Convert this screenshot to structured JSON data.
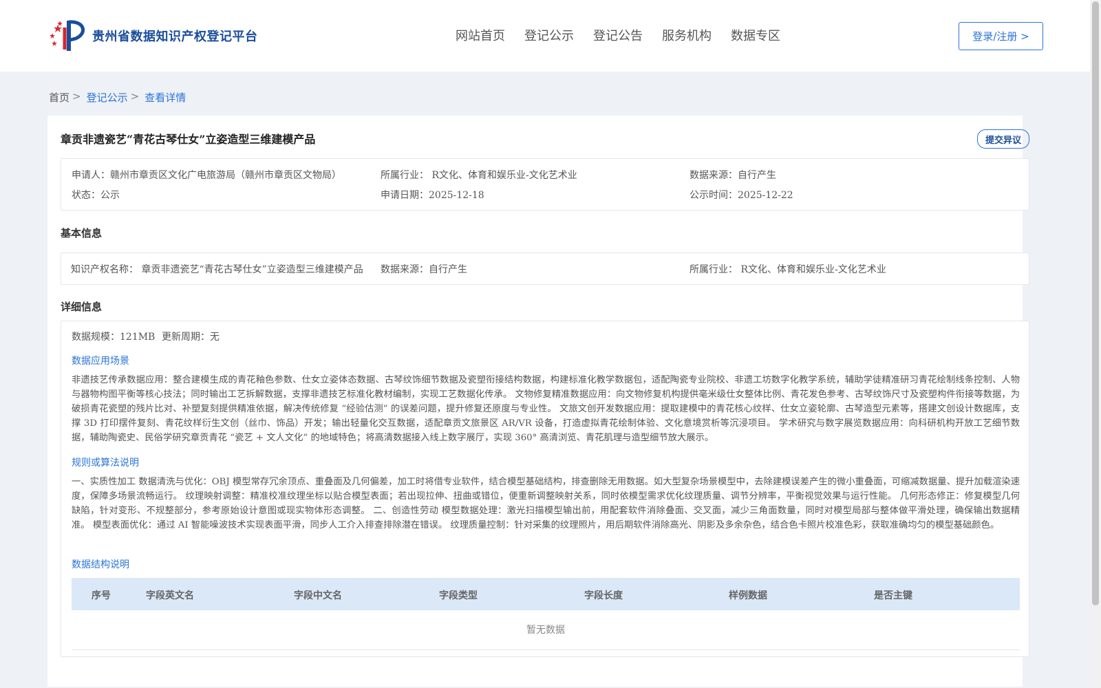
{
  "header": {
    "site_name": "贵州省数据知识产权登记平台",
    "nav": [
      "网站首页",
      "登记公示",
      "登记公告",
      "服务机构",
      "数据专区"
    ],
    "login_label": "登录/注册 >"
  },
  "breadcrumb": {
    "home": "首页",
    "sep": ">",
    "section": "登记公示",
    "current": "查看详情"
  },
  "detail": {
    "title": "章贡非遗瓷艺“青花古琴仕女”立姿造型三维建模产品",
    "objection_label": "提交异议",
    "summary": {
      "applicant": "申请人：赣州市章贡区文化广电旅游局（赣州市章贡区文物局）",
      "industry": "所属行业： R文化、体育和娱乐业-文化艺术业",
      "source": "数据来源：自行产生",
      "status": "状态：公示",
      "apply_date": "申请日期：2025-12-18",
      "publish_date": "公示时间：2025-12-22"
    },
    "basic_title": "基本信息",
    "basic": {
      "ip_name": "知识产权名称： 章贡非遗瓷艺“青花古琴仕女”立姿造型三维建模产品",
      "source": "数据来源：自行产生",
      "industry": "所属行业： R文化、体育和娱乐业-文化艺术业"
    },
    "detail_title": "详细信息",
    "scale": "数据规模：121MB",
    "update_cycle": "更新周期：无",
    "scene_title": "数据应用场景",
    "scene_text": "非遗技艺传承数据应用：整合建模生成的青花釉色参数、仕女立姿体态数据、古琴纹饰细节数据及瓷塑衔接结构数据，构建标准化教学数据包，适配陶瓷专业院校、非遗工坊数字化教学系统，辅助学徒精准研习青花绘制线条控制、人物与器物构图平衡等核心技法；同时输出工艺拆解数据，支撑非遗技艺标准化教材编制，实现工艺数据化传承。 文物修复精准数据应用：向文物修复机构提供毫米级仕女整体比例、青花发色参考、古琴纹饰尺寸及瓷塑构件衔接等数据，为破损青花瓷塑的残片比对、补塑复刻提供精准依据，解决传统修复 “经验估测” 的误差问题，提升修复还原度与专业性。 文旅文创开发数据应用：提取建模中的青花核心纹样、仕女立姿轮廓、古琴造型元素等，搭建文创设计数据库，支撑 3D 打印摆件复刻、青花纹样衍生文创（丝巾、饰品）开发；输出轻量化交互数据，适配章贡文旅景区 AR/VR 设备，打造虚拟青花绘制体验、文化意境赏析等沉浸项目。 学术研究与数字展览数据应用：向科研机构开放工艺细节数据，辅助陶瓷史、民俗学研究章贡青花 “瓷艺 + 文人文化” 的地域特色；将高清数据接入线上数字展厅，实现 360° 高清浏览、青花肌理与造型细节放大展示。",
    "rule_title": "规则或算法说明",
    "rule_text": "一、实质性加工 数据清洗与优化：OBJ 模型常存冗余顶点、重叠面及几何偏差，加工时将借专业软件，结合模型基础结构，排查删除无用数据。如大型复杂场景模型中，去除建模误差产生的微小重叠面，可缩减数据量、提升加载渲染速度，保障多场景流畅运行。 纹理映射调整：精准校准纹理坐标以贴合模型表面；若出现拉伸、扭曲或错位，便重新调整映射关系，同时依模型需求优化纹理质量、调节分辨率，平衡视觉效果与运行性能。 几何形态修正：修复模型几何缺陷，针对变形、不规整部分，参考原始设计意图或现实物体形态调整。 二、创造性劳动 模型数据处理：激光扫描模型输出前，用配套软件消除叠面、交叉面，减少三角面数量，同时对模型局部与整体做平滑处理，确保输出数据精准。 模型表面优化：通过 AI 智能噪波技术实现表面平滑，同步人工介入排查排除潜在错误。 纹理质量控制：针对采集的纹理照片，用后期软件消除高光、阴影及多余杂色，结合色卡照片校准色彩，获取准确均匀的模型基础颜色。",
    "struct_title": "数据结构说明",
    "table_headers": [
      "序号",
      "字段英文名",
      "字段中文名",
      "字段类型",
      "字段长度",
      "样例数据",
      "是否主键"
    ],
    "empty_text": "暂无数据"
  },
  "colors": {
    "brand_blue": "#1a4d9c",
    "link_blue": "#2a74d6",
    "page_bg": "#eef1f6",
    "table_head_bg": "#dbe8f8"
  }
}
